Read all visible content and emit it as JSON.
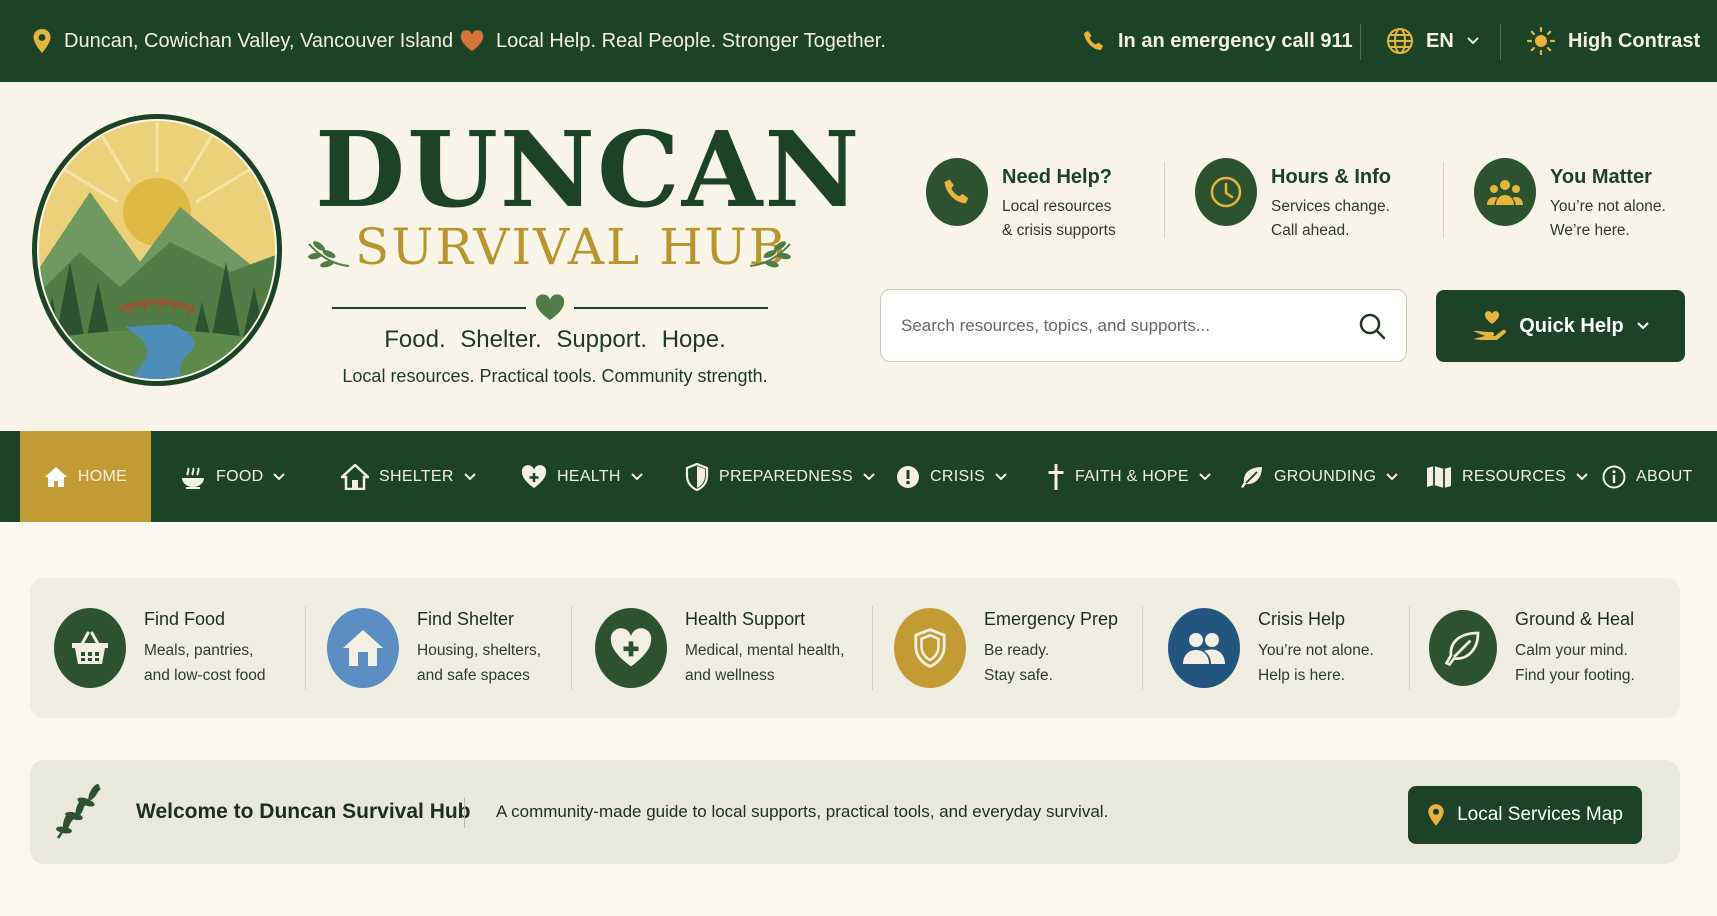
{
  "topbar": {
    "location": "Duncan, Cowichan Valley, Vancouver Island",
    "motto": "Local Help. Real People. Stronger Together.",
    "emergency": "In an emergency call 911",
    "language": "EN",
    "contrast": "High Contrast"
  },
  "brand": {
    "title": "DUNCAN",
    "subtitle": "SURVIVAL HUB",
    "tagline": "Food.  Shelter.  Support.  Hope.",
    "tagline2": "Local resources. Practical tools. Community strength."
  },
  "info": [
    {
      "title": "Need Help?",
      "line1": "Local resources",
      "line2": "& crisis supports",
      "icon": "phone-icon"
    },
    {
      "title": "Hours & Info",
      "line1": "Services change.",
      "line2": "Call ahead.",
      "icon": "clock-icon"
    },
    {
      "title": "You Matter",
      "line1": "You’re not alone.",
      "line2": "We’re here.",
      "icon": "people-icon"
    }
  ],
  "search": {
    "placeholder": "Search resources, topics, and supports..."
  },
  "quick_help": {
    "label": "Quick Help"
  },
  "nav": [
    {
      "label": "HOME",
      "icon": "home-icon"
    },
    {
      "label": "FOOD",
      "icon": "bowl-icon"
    },
    {
      "label": "SHELTER",
      "icon": "house-icon"
    },
    {
      "label": "HEALTH",
      "icon": "heart-plus-icon"
    },
    {
      "label": "PREPAREDNESS",
      "icon": "shield-icon"
    },
    {
      "label": "CRISIS",
      "icon": "alert-icon"
    },
    {
      "label": "FAITH & HOPE",
      "icon": "cross-icon"
    },
    {
      "label": "GROUNDING",
      "icon": "leaf-icon"
    },
    {
      "label": "RESOURCES",
      "icon": "map-icon"
    },
    {
      "label": "ABOUT",
      "icon": "info-icon"
    }
  ],
  "cards": [
    {
      "title": "Find Food",
      "line1": "Meals, pantries,",
      "line2": "and low-cost food",
      "color": "#2c5230",
      "icon": "basket-icon"
    },
    {
      "title": "Find Shelter",
      "line1": "Housing, shelters,",
      "line2": "and safe spaces",
      "color": "#5b8ec3",
      "icon": "house-icon"
    },
    {
      "title": "Health Support",
      "line1": "Medical, mental health,",
      "line2": "and wellness",
      "color": "#2c5230",
      "icon": "heart-plus-icon"
    },
    {
      "title": "Emergency Prep",
      "line1": "Be ready.",
      "line2": "Stay safe.",
      "color": "#c39b35",
      "icon": "shield-icon"
    },
    {
      "title": "Crisis Help",
      "line1": "You’re not alone.",
      "line2": "Help is here.",
      "color": "#22557f",
      "icon": "people-icon"
    },
    {
      "title": "Ground & Heal",
      "line1": "Calm your mind.",
      "line2": "Find your footing.",
      "color": "#2c5230",
      "icon": "leaf-icon"
    }
  ],
  "welcome": {
    "title": "Welcome to Duncan Survival Hub",
    "description": "A community-made guide to local supports, practical tools, and everyday survival.",
    "map_button": "Local Services Map"
  },
  "colors": {
    "primary": "#1c4326",
    "gold": "#c39b35",
    "cream": "#f8f4e8"
  }
}
